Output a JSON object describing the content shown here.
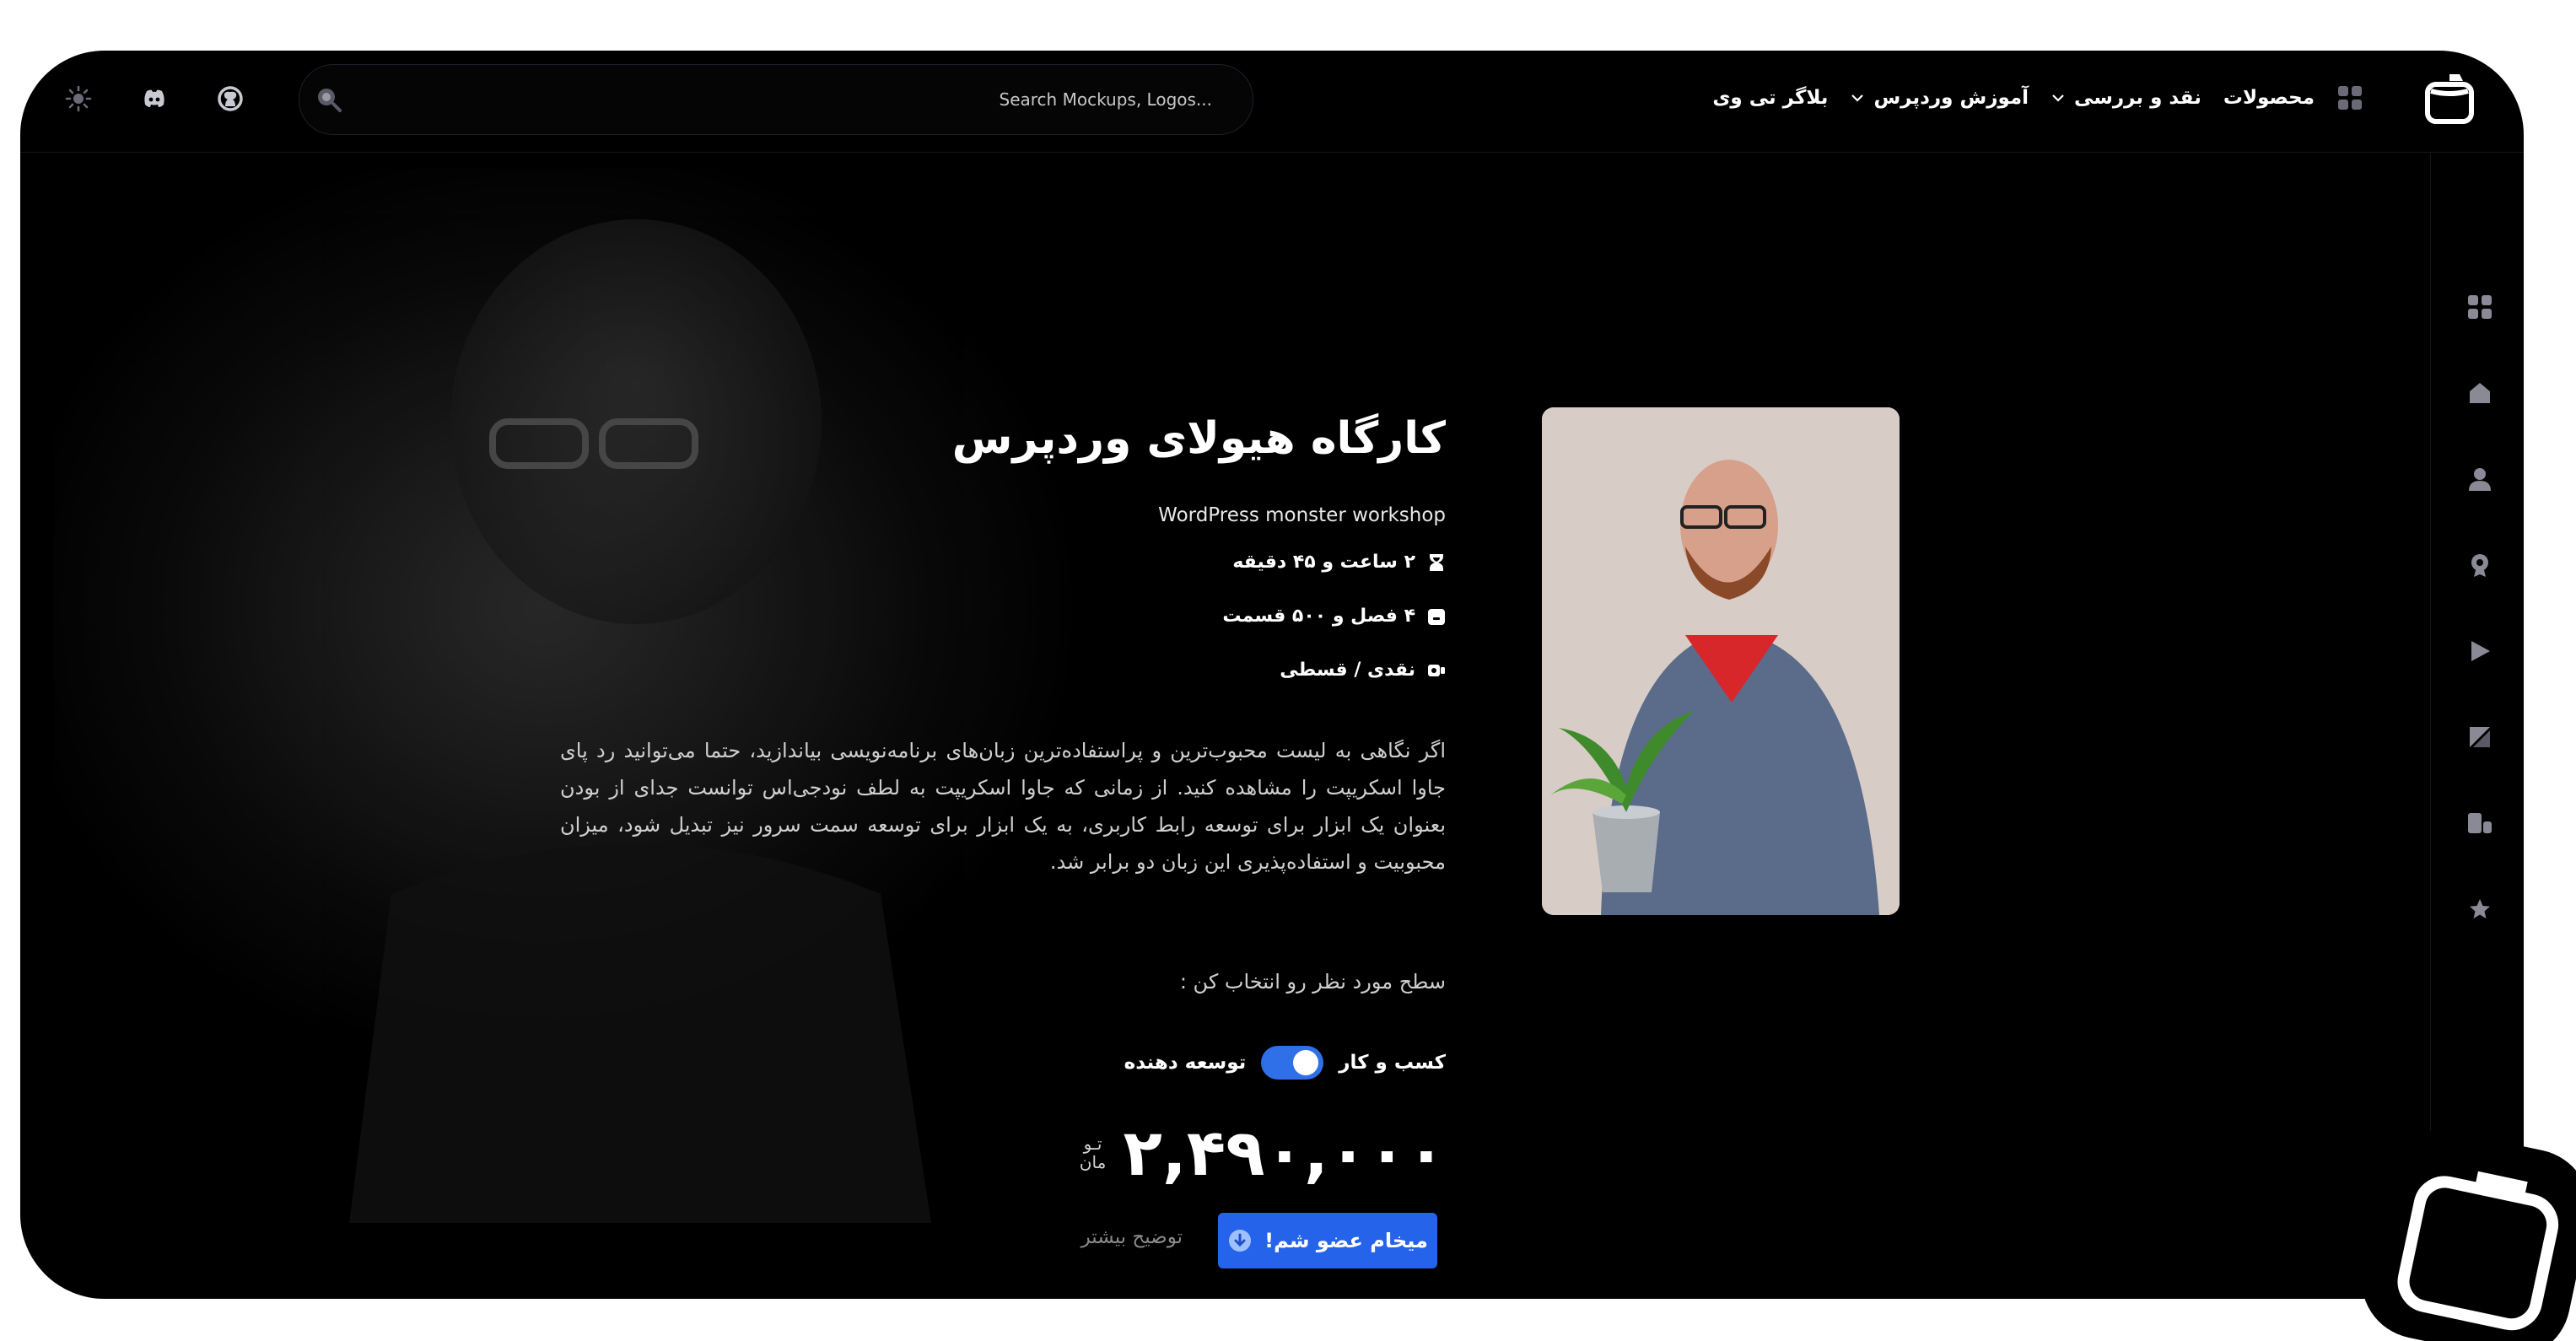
{
  "header": {
    "nav": [
      {
        "label": "بلاگر تی وی",
        "has_dropdown": false
      },
      {
        "label": "آموزش وردپرس",
        "has_dropdown": true
      },
      {
        "label": "نقد و بررسی",
        "has_dropdown": true
      },
      {
        "label": "محصولات",
        "has_dropdown": false
      }
    ],
    "search_placeholder": "Search Mockups, Logos..."
  },
  "sidebar": {
    "icons": [
      "apps-icon",
      "home-icon",
      "user-icon",
      "award-icon",
      "play-icon",
      "document-icon",
      "video-icon",
      "star-icon"
    ]
  },
  "course": {
    "title": "کارگاه هیولای وردپرس",
    "subtitle": "WordPress monster workshop",
    "duration": "۲ ساعت و ۴۵ دقیقه",
    "chapters": "۴ فصل و ۵۰۰ قسمت",
    "payment": "نقدی / قسطی",
    "description": "اگر نگاهی به لیست محبوب‌ترین و پراستفاده‌ترین زبان‌های برنامه‌نویسی بیاندازید، حتما می‌توانید رد پای جاوا اسکریپت را مشاهده کنید. از زمانی که جاوا اسکریپت به لطف نودجی‌اس توانست جدای از بودن بعنوان یک ابزار برای توسعه رابط کاربری، به یک ابزار برای توسعه سمت سرور نیز تبدیل شود، میزان محبوبیت و استفاده‌پذیری این زبان دو برابر شد.",
    "level_prompt": "سطح مورد نظر رو انتخاب کن :",
    "toggle_left": "کسب و کار",
    "toggle_right": "توسعه دهنده",
    "price": "۲,۴۹۰,۰۰۰",
    "currency_line1": "تـو",
    "currency_line2": "مان",
    "cta_label": "میخام عضو شم!",
    "more_label": "توضیح بیشتر"
  },
  "colors": {
    "accent": "#2563eb",
    "background": "#000000",
    "text": "#ffffff"
  }
}
